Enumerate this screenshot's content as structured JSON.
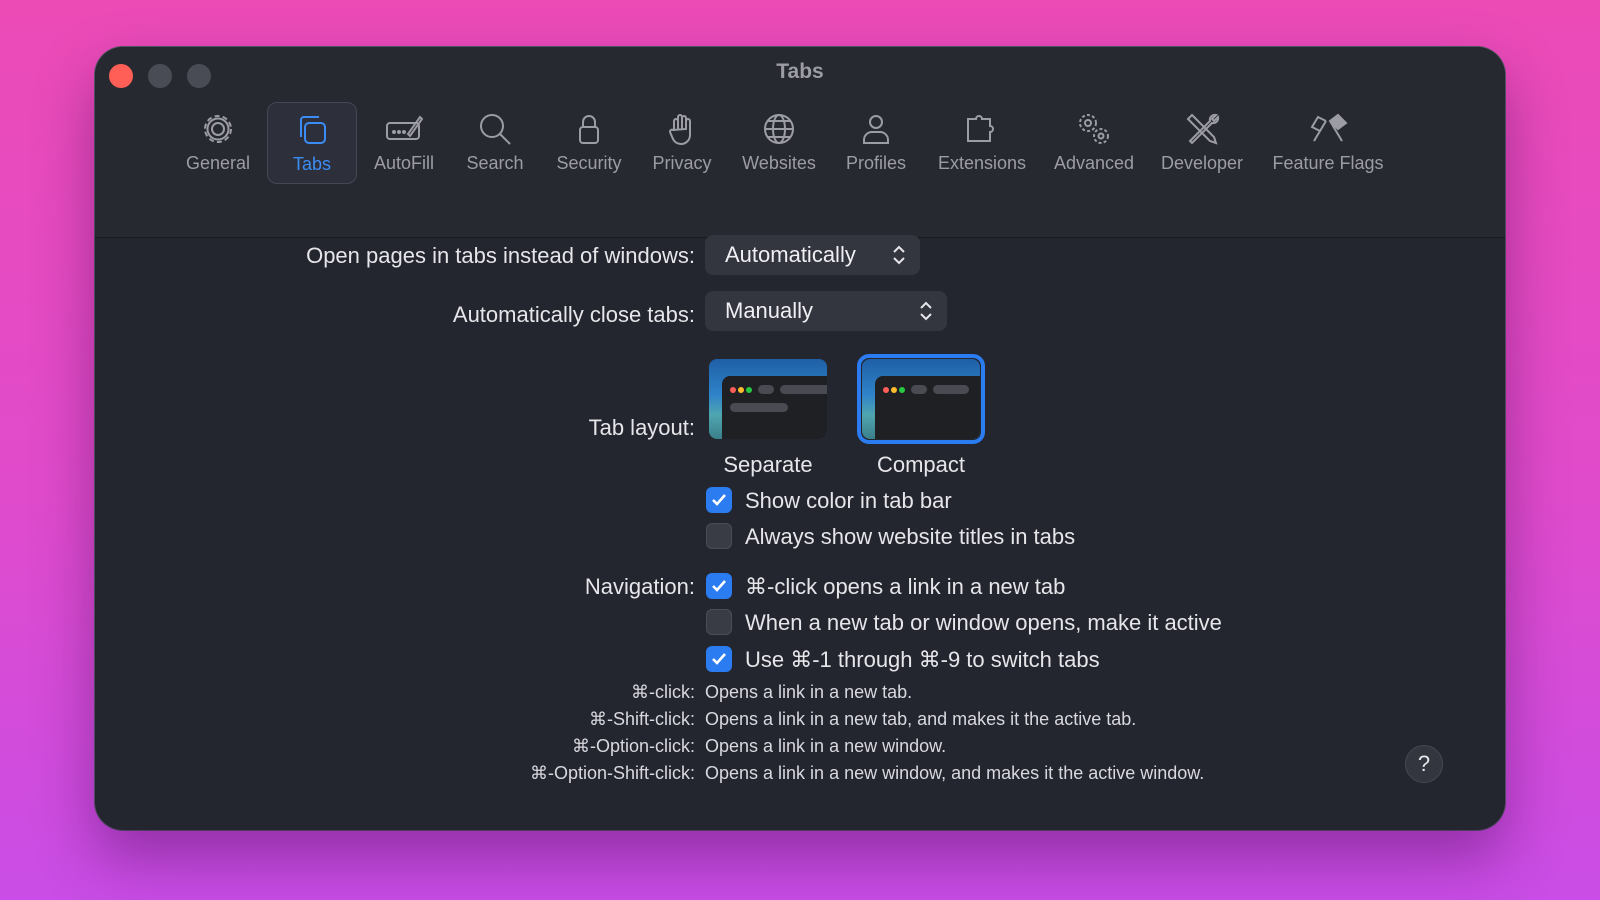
{
  "window": {
    "title": "Tabs"
  },
  "toolbar": {
    "items": [
      {
        "label": "General",
        "icon": "gear-icon"
      },
      {
        "label": "Tabs",
        "icon": "tabs-icon"
      },
      {
        "label": "AutoFill",
        "icon": "autofill-icon"
      },
      {
        "label": "Search",
        "icon": "search-icon"
      },
      {
        "label": "Security",
        "icon": "lock-icon"
      },
      {
        "label": "Privacy",
        "icon": "hand-icon"
      },
      {
        "label": "Websites",
        "icon": "globe-icon"
      },
      {
        "label": "Profiles",
        "icon": "person-icon"
      },
      {
        "label": "Extensions",
        "icon": "puzzle-icon"
      },
      {
        "label": "Advanced",
        "icon": "gears-icon"
      },
      {
        "label": "Developer",
        "icon": "wrench-screwdriver-icon"
      },
      {
        "label": "Feature Flags",
        "icon": "flags-icon"
      }
    ],
    "selected": "Tabs"
  },
  "settings": {
    "open_pages": {
      "label": "Open pages in tabs instead of windows:",
      "value": "Automatically"
    },
    "close_tabs": {
      "label": "Automatically close tabs:",
      "value": "Manually"
    },
    "tab_layout": {
      "label": "Tab layout:",
      "options": [
        "Separate",
        "Compact"
      ],
      "selected": "Compact"
    },
    "show_color": {
      "label": "Show color in tab bar",
      "checked": true
    },
    "always_titles": {
      "label": "Always show website titles in tabs",
      "checked": false
    },
    "navigation": {
      "label": "Navigation:",
      "options": [
        {
          "label": "⌘-click opens a link in a new tab",
          "checked": true
        },
        {
          "label": "When a new tab or window opens, make it active",
          "checked": false
        },
        {
          "label": "Use ⌘-1 through ⌘-9 to switch tabs",
          "checked": true
        }
      ]
    },
    "hints": [
      {
        "key": "⌘-click:",
        "desc": "Opens a link in a new tab."
      },
      {
        "key": "⌘-Shift-click:",
        "desc": "Opens a link in a new tab, and makes it the active tab."
      },
      {
        "key": "⌘-Option-click:",
        "desc": "Opens a link in a new window."
      },
      {
        "key": "⌘-Option-Shift-click:",
        "desc": "Opens a link in a new window, and makes it the active window."
      }
    ]
  },
  "help": {
    "label": "?"
  },
  "colors": {
    "accent": "#2a7cf0",
    "window_bg": "#24262f",
    "close": "#ff5f57"
  }
}
